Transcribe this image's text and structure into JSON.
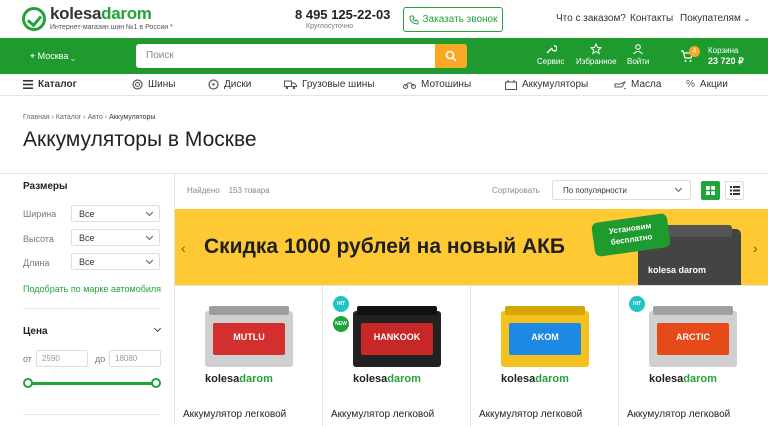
{
  "header": {
    "logo_name_a": "kolesa",
    "logo_name_b": "darom",
    "logo_tagline": "Интернет-магазин шин №1 в России *",
    "phone": "8 495 125-22-03",
    "phone_note": "Круглосуточно",
    "callback_label": "Заказать звонок",
    "links": [
      "Что с заказом?",
      "Контакты",
      "Покупателям"
    ]
  },
  "greenbar": {
    "city": "Москва",
    "search_placeholder": "Поиск",
    "service": "Сервис",
    "favorites": "Избранное",
    "login": "Войти",
    "cart_label": "Корзина",
    "cart_count": "4",
    "cart_total": "23 720 ₽"
  },
  "nav": {
    "catalog": "Каталог",
    "items": [
      "Шины",
      "Диски",
      "Грузовые шины",
      "Мотошины",
      "Аккумуляторы",
      "Масла",
      "Акции"
    ]
  },
  "breadcrumbs": [
    "Главная",
    "Каталог",
    "Авто",
    "Аккумуляторы"
  ],
  "page_title": "Аккумуляторы в Москве",
  "filters": {
    "sizes_title": "Размеры",
    "width_label": "Ширина",
    "width_value": "Все",
    "height_label": "Высота",
    "height_value": "Все",
    "length_label": "Длина",
    "length_value": "Все",
    "pick_by_car": "Подобрать по марке автомобиля",
    "price_title": "Цена",
    "from_label": "от",
    "from_value": "2590",
    "to_label": "до",
    "to_value": "18080"
  },
  "listing": {
    "found_label": "Найдено",
    "found_count": "153 товара",
    "sort_label": "Сортировать",
    "sort_value": "По популярности"
  },
  "banner": {
    "text": "Скидка 1000 рублей на новый АКБ",
    "badge_line1": "Установим",
    "badge_line2": "бесплатно",
    "battery_brand": "kolesa darom"
  },
  "products": [
    {
      "label": "MUTLU",
      "title": "Аккумулятор легковой",
      "badges": [],
      "accent": "#d32f2f"
    },
    {
      "label": "HANKOOK",
      "title": "Аккумулятор легковой",
      "badges": [
        "HIT",
        "NEW"
      ],
      "accent": "#c62828"
    },
    {
      "label": "AKOM",
      "title": "Аккумулятор легковой",
      "badges": [],
      "accent": "#f9b800"
    },
    {
      "label": "ARCTIC",
      "title": "Аккумулятор легковой",
      "badges": [
        "HIT"
      ],
      "accent": "#e64a19"
    }
  ],
  "card_brand_a": "kolesa",
  "card_brand_b": "darom",
  "colors": {
    "brand_green": "#1f9a2f",
    "accent_orange": "#f9a825",
    "banner_yellow": "#ffc933",
    "hit_badge": "#20c4c4",
    "new_badge": "#22a33a"
  }
}
